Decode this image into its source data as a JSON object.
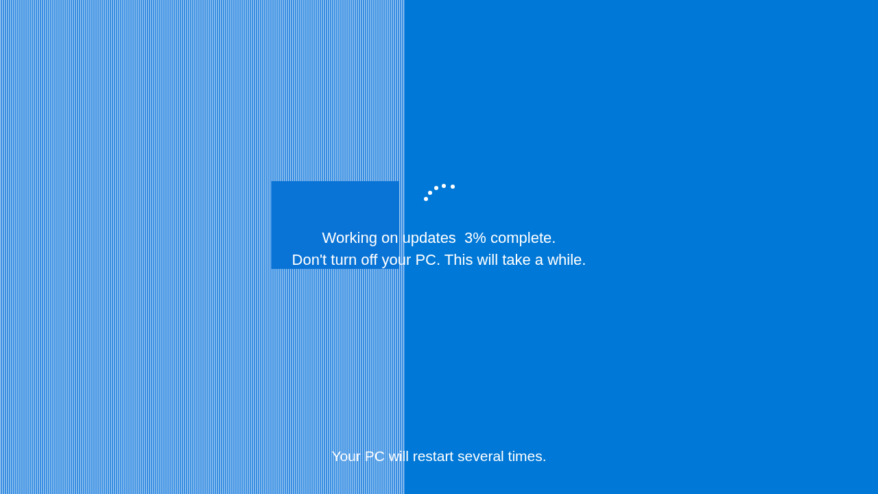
{
  "progress_message": "Working on updates  3% complete.",
  "warning": "Don't turn off your PC. This will take a while.",
  "restart_note": "Your PC will restart several times."
}
